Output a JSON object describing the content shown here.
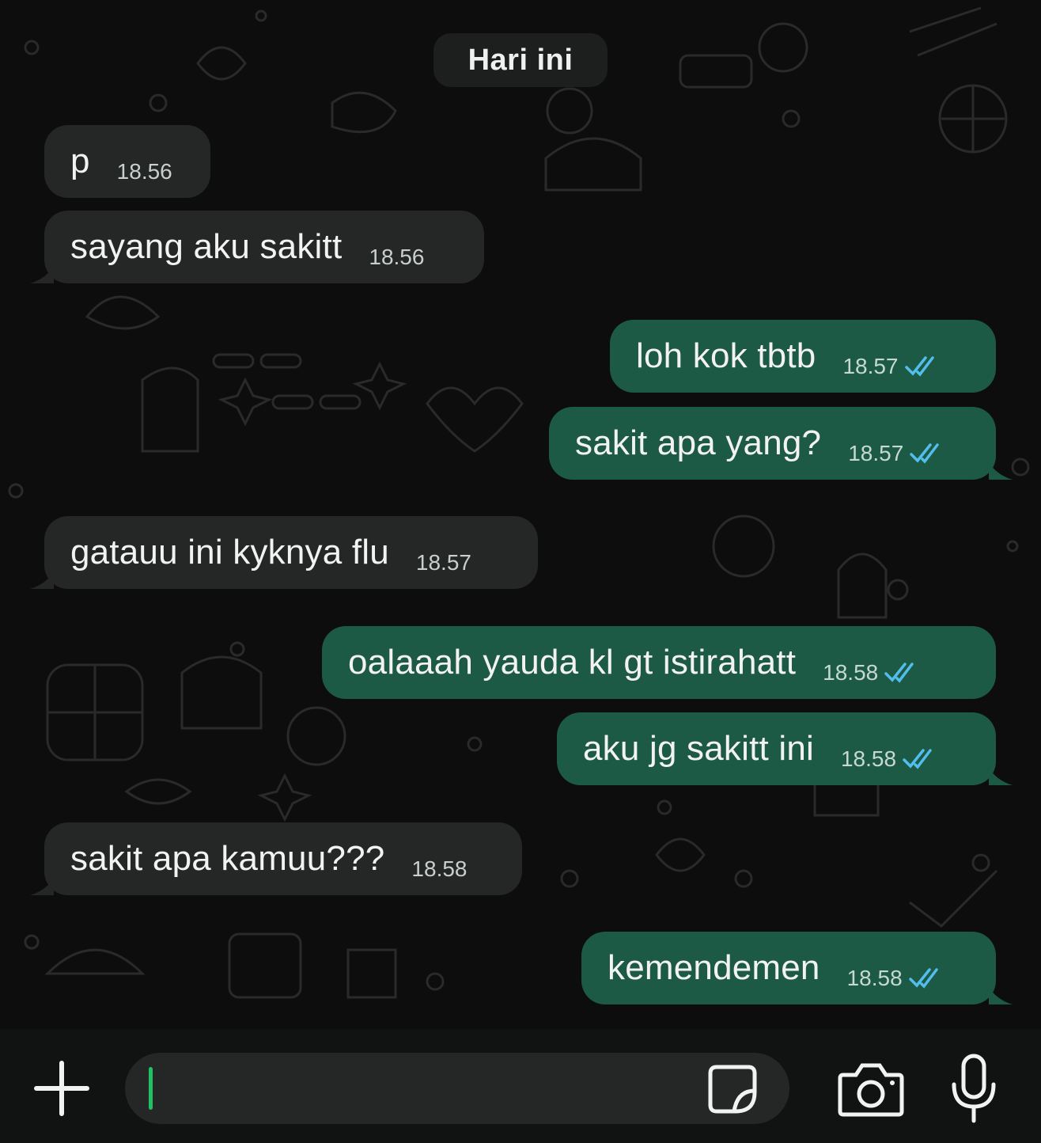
{
  "date_separator": "Hari ini",
  "messages": [
    {
      "direction": "incoming",
      "text": "p",
      "time": "18.56"
    },
    {
      "direction": "incoming",
      "text": "sayang aku sakitt",
      "time": "18.56"
    },
    {
      "direction": "outgoing",
      "text": "loh kok tbtb",
      "time": "18.57",
      "status": "read"
    },
    {
      "direction": "outgoing",
      "text": "sakit apa yang?",
      "time": "18.57",
      "status": "read"
    },
    {
      "direction": "incoming",
      "text": "gatauu ini kyknya flu",
      "time": "18.57"
    },
    {
      "direction": "outgoing",
      "text": "oalaaah yauda kl gt istirahatt",
      "time": "18.58",
      "status": "read"
    },
    {
      "direction": "outgoing",
      "text": "aku jg sakitt ini",
      "time": "18.58",
      "status": "read"
    },
    {
      "direction": "incoming",
      "text": "sakit apa kamuu???",
      "time": "18.58"
    },
    {
      "direction": "outgoing",
      "text": "kemendemen",
      "time": "18.58",
      "status": "read"
    }
  ],
  "composer": {
    "input_value": "",
    "icons": [
      "plus-icon",
      "sticker-icon",
      "camera-icon",
      "microphone-icon"
    ]
  },
  "colors": {
    "background": "#0d0d0d",
    "incoming_bubble": "#252626",
    "outgoing_bubble": "#1d5a45",
    "read_ticks": "#53bdeb",
    "caret": "#21c063"
  }
}
